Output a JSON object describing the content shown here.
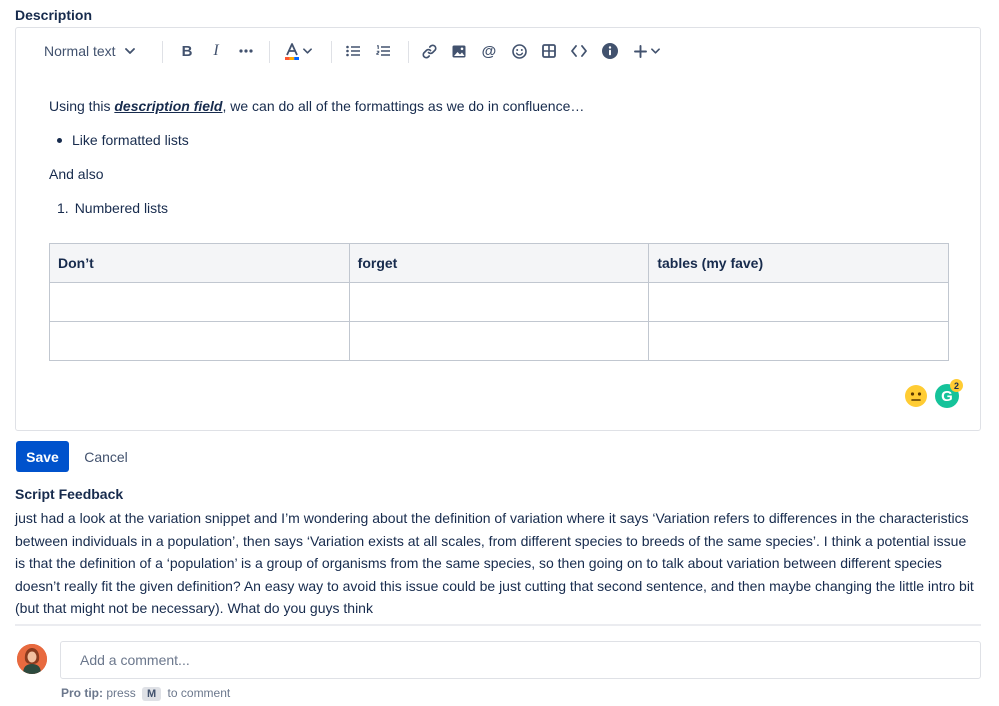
{
  "description_label": "Description",
  "toolbar": {
    "text_style": "Normal text",
    "bold_icon": "bold-icon",
    "italic_icon": "italic-icon",
    "more_icon": "more-formatting-icon",
    "text_color_icon": "text-color-icon",
    "bullet_list_icon": "bullet-list-icon",
    "numbered_list_icon": "numbered-list-icon",
    "link_icon": "link-icon",
    "image_icon": "image-icon",
    "mention_icon": "mention-icon",
    "emoji_icon": "emoji-icon",
    "table_icon": "table-icon",
    "code_icon": "code-icon",
    "info_icon": "info-icon",
    "insert_icon": "plus-icon"
  },
  "editor": {
    "line1_before": "Using this ",
    "line1_emphasis": "description field",
    "line1_after": ", we can do all of the formattings as we do in confluence…",
    "bullet_item": "Like formatted lists",
    "and_also": "And also",
    "numbered_item": "Numbered lists",
    "table": {
      "headers": [
        "Don’t",
        "forget",
        "tables (my fave)"
      ],
      "rows": [
        [
          "",
          "",
          ""
        ],
        [
          "",
          "",
          ""
        ]
      ]
    },
    "grammarly_count": "2"
  },
  "actions": {
    "save_label": "Save",
    "cancel_label": "Cancel"
  },
  "feedback": {
    "label": "Script Feedback",
    "body": "just had a look at the variation snippet and I’m wondering about the definition of variation where it says ‘Variation refers to differences in the characteristics between individuals in a population’, then says ‘Variation exists at all scales, from different species to breeds of the same species’. I think a potential issue is that the definition of a ‘population’ is a group of organisms from the same species, so then going on to talk about variation between different species doesn’t really fit the given definition? An easy way to avoid this issue could be just cutting that second sentence, and then maybe changing the little intro bit (but that might not be necessary). What do you guys think"
  },
  "comment": {
    "placeholder": "Add a comment...",
    "protip_label": "Pro tip:",
    "protip_press": "press",
    "protip_key": "M",
    "protip_after": "to comment"
  },
  "colors": {
    "primary": "#0052cc",
    "text": "#172b4d",
    "subtle": "#42526e",
    "border": "#dfe1e6",
    "grammarly": "#15c39a"
  }
}
